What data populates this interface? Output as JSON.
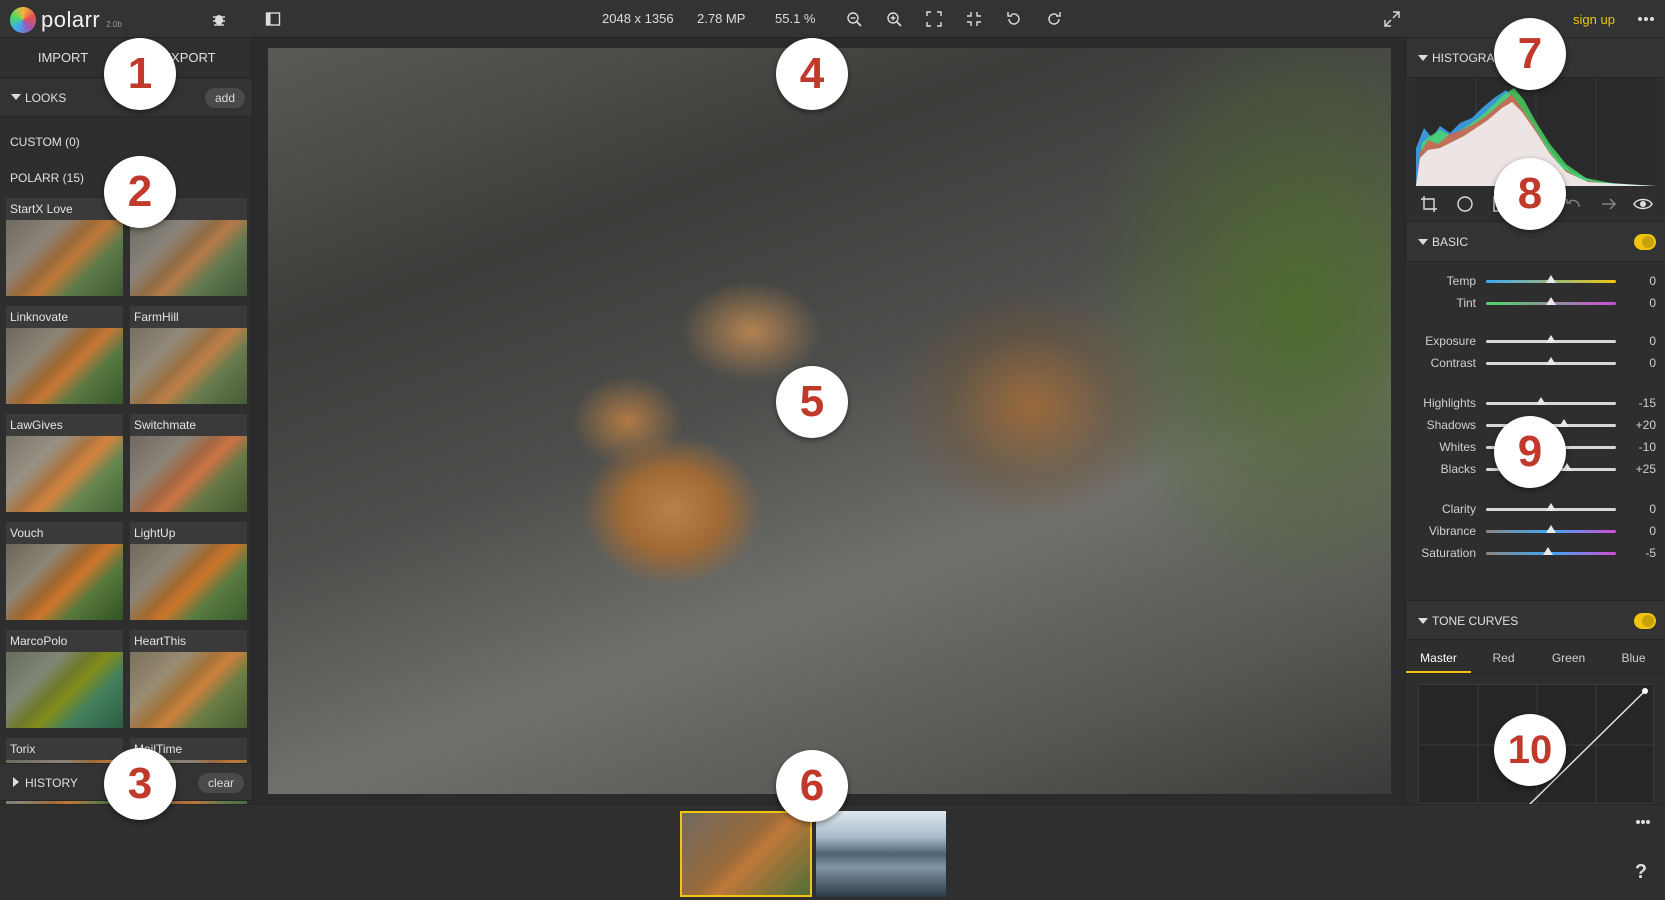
{
  "app": {
    "name": "polarr",
    "version": "2.0b"
  },
  "topbar": {
    "dimensions": "2048 x 1356",
    "megapixels": "2.78 MP",
    "zoom": "55.1 %",
    "signup_label": "sign up"
  },
  "left": {
    "tab_import": "IMPORT",
    "tab_export": "EXPORT",
    "looks_label": "LOOKS",
    "add_label": "add",
    "custom_label": "CUSTOM (0)",
    "polarr_label": "POLARR (15)",
    "looks": [
      {
        "name": "StartX Love"
      },
      {
        "name": ""
      },
      {
        "name": "Linknovate"
      },
      {
        "name": "FarmHill"
      },
      {
        "name": "LawGives"
      },
      {
        "name": "Switchmate"
      },
      {
        "name": "Vouch"
      },
      {
        "name": "LightUp"
      },
      {
        "name": "MarcoPolo"
      },
      {
        "name": "HeartThis"
      },
      {
        "name": "Torix"
      },
      {
        "name": "MailTime"
      }
    ],
    "history_label": "HISTORY",
    "clear_label": "clear"
  },
  "right": {
    "histogram_label": "HISTOGRAM",
    "basic_label": "BASIC",
    "sliders": [
      {
        "label": "Temp",
        "value": "0",
        "pos": 0.5
      },
      {
        "label": "Tint",
        "value": "0",
        "pos": 0.5
      },
      {
        "label": "Exposure",
        "value": "0",
        "pos": 0.5
      },
      {
        "label": "Contrast",
        "value": "0",
        "pos": 0.5
      },
      {
        "label": "Highlights",
        "value": "-15",
        "pos": 0.42
      },
      {
        "label": "Shadows",
        "value": "+20",
        "pos": 0.6
      },
      {
        "label": "Whites",
        "value": "-10",
        "pos": 0.45
      },
      {
        "label": "Blacks",
        "value": "+25",
        "pos": 0.62
      },
      {
        "label": "Clarity",
        "value": "0",
        "pos": 0.5
      },
      {
        "label": "Vibrance",
        "value": "0",
        "pos": 0.5
      },
      {
        "label": "Saturation",
        "value": "-5",
        "pos": 0.48
      }
    ],
    "tone_curves_label": "TONE CURVES",
    "curve_tabs": [
      "Master",
      "Red",
      "Green",
      "Blue"
    ]
  },
  "callouts": [
    "1",
    "2",
    "3",
    "4",
    "5",
    "6",
    "7",
    "8",
    "9",
    "10"
  ],
  "colors": {
    "accent": "#f1c40f",
    "callout_text": "#c0392b"
  }
}
